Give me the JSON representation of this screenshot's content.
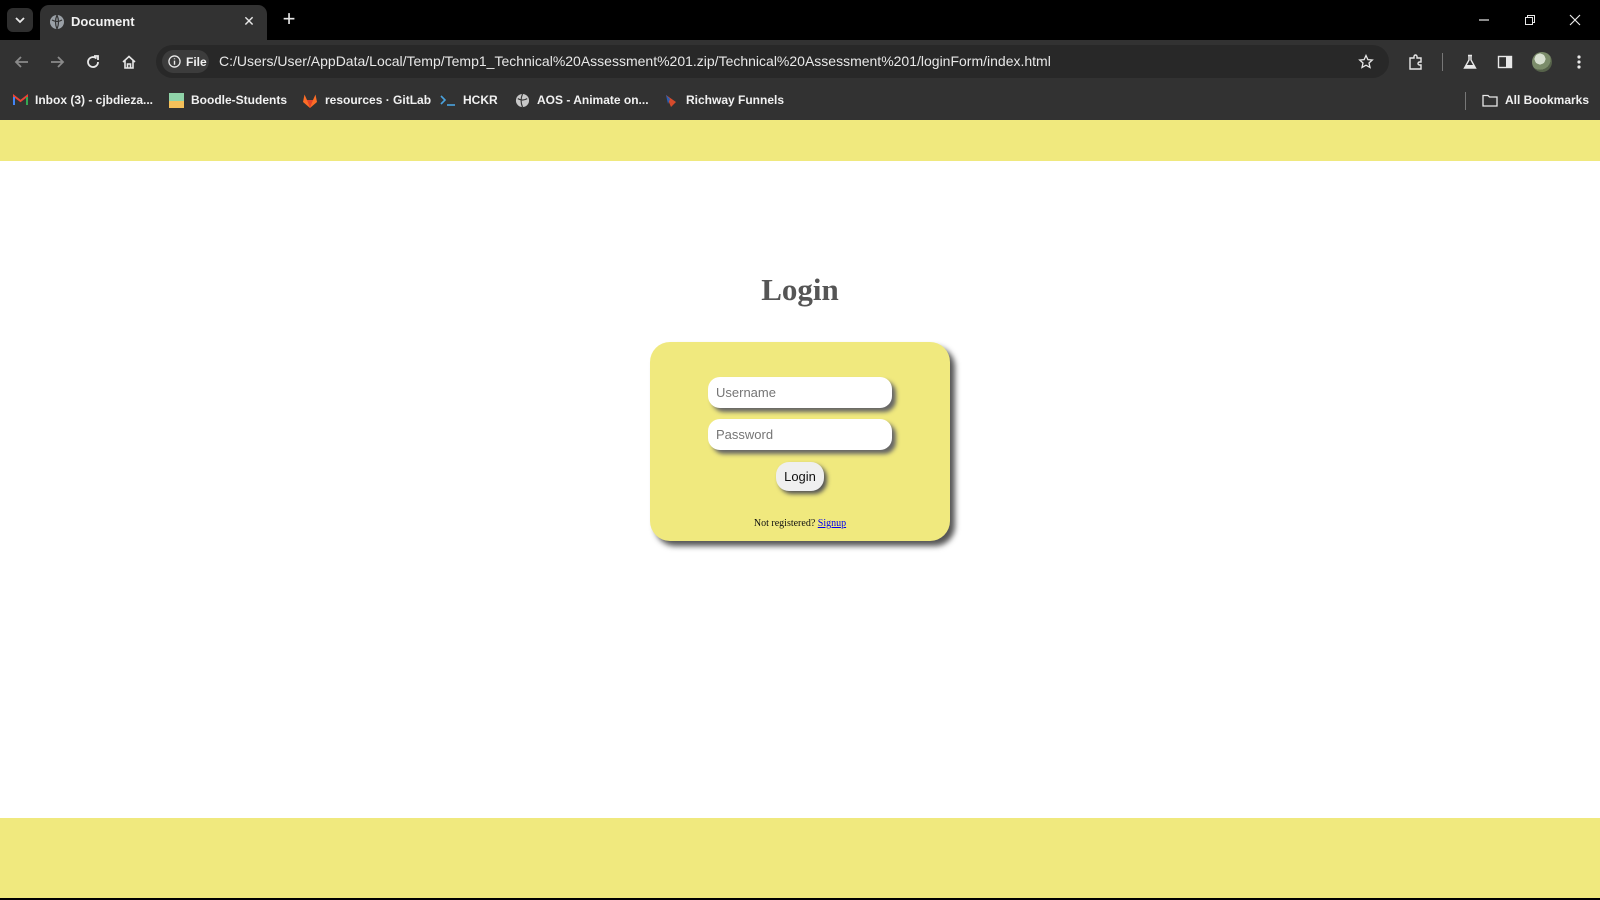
{
  "browser": {
    "tab": {
      "title": "Document",
      "close_icon": "close-icon"
    },
    "address_bar": {
      "site_chip_label": "File",
      "url": "C:/Users/User/AppData/Local/Temp/Temp1_Technical%20Assessment%201.zip/Technical%20Assessment%201/loginForm/index.html"
    },
    "bookmarks": [
      {
        "label": "Inbox (3) - cjbdieza...",
        "icon": "gmail-icon"
      },
      {
        "label": "Boodle-Students",
        "icon": "boodle-icon"
      },
      {
        "label": "resources · GitLab",
        "icon": "gitlab-icon"
      },
      {
        "label": "HCKR",
        "icon": "terminal-icon"
      },
      {
        "label": "AOS - Animate on...",
        "icon": "globe-icon"
      },
      {
        "label": "Richway Funnels",
        "icon": "funnel-icon"
      }
    ],
    "all_bookmarks_label": "All Bookmarks"
  },
  "page": {
    "title": "Login",
    "form": {
      "username_placeholder": "Username",
      "password_placeholder": "Password",
      "login_button": "Login",
      "signup_prompt": "Not registered?",
      "signup_link": "Signup"
    }
  },
  "colors": {
    "accent_yellow": "#f0e97e",
    "page_background": "#ffffff",
    "browser_dark": "#323232"
  }
}
